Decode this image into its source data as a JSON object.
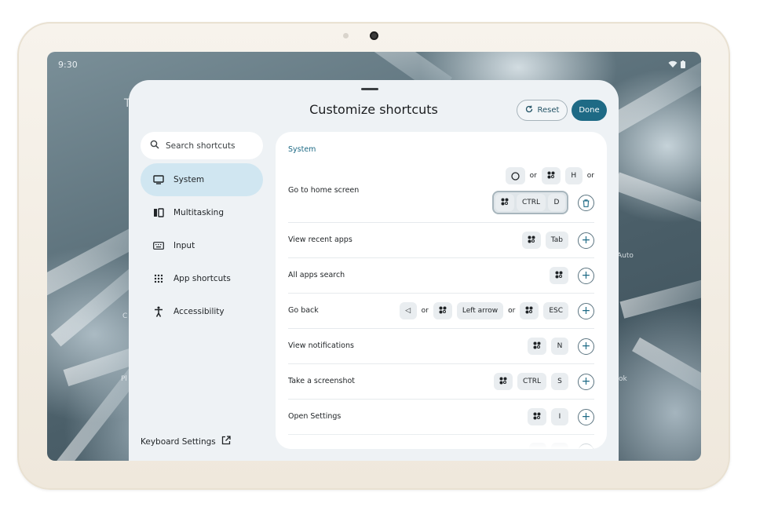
{
  "status_bar": {
    "time": "9:30"
  },
  "background_labels": {
    "auto": "Auto",
    "ok": "ok",
    "pl": "Pl",
    "t": "T",
    "c": "C"
  },
  "sheet": {
    "title": "Customize shortcuts",
    "reset_label": "Reset",
    "done_label": "Done"
  },
  "sidebar": {
    "search_placeholder": "Search shortcuts",
    "items": [
      {
        "label": "System",
        "icon": "monitor-icon",
        "active": true
      },
      {
        "label": "Multitasking",
        "icon": "split-screen-icon"
      },
      {
        "label": "Input",
        "icon": "keyboard-icon"
      },
      {
        "label": "App shortcuts",
        "icon": "grid-dots-icon"
      },
      {
        "label": "Accessibility",
        "icon": "accessibility-icon"
      }
    ],
    "keyboard_settings_label": "Keyboard Settings"
  },
  "panel": {
    "section_title": "System",
    "or_label": "or",
    "rows": [
      {
        "label": "Go to home screen",
        "line1": [
          "○",
          "meta",
          "H"
        ],
        "line2": [
          "meta",
          "CTRL",
          "D"
        ]
      },
      {
        "label": "View recent apps",
        "keys": [
          "meta",
          "Tab"
        ]
      },
      {
        "label": "All apps search",
        "keys": [
          "meta"
        ]
      },
      {
        "label": "Go back",
        "keys": [
          "◁",
          "meta",
          "Left arrow",
          "meta",
          "ESC"
        ]
      },
      {
        "label": "View notifications",
        "keys": [
          "meta",
          "N"
        ]
      },
      {
        "label": "Take a screenshot",
        "keys": [
          "meta",
          "CTRL",
          "S"
        ]
      },
      {
        "label": "Open Settings",
        "keys": [
          "meta",
          "I"
        ]
      }
    ]
  },
  "colors": {
    "accent": "#1e6a85",
    "active_nav": "#d0e6f1",
    "sheet_bg": "#eef2f5"
  }
}
